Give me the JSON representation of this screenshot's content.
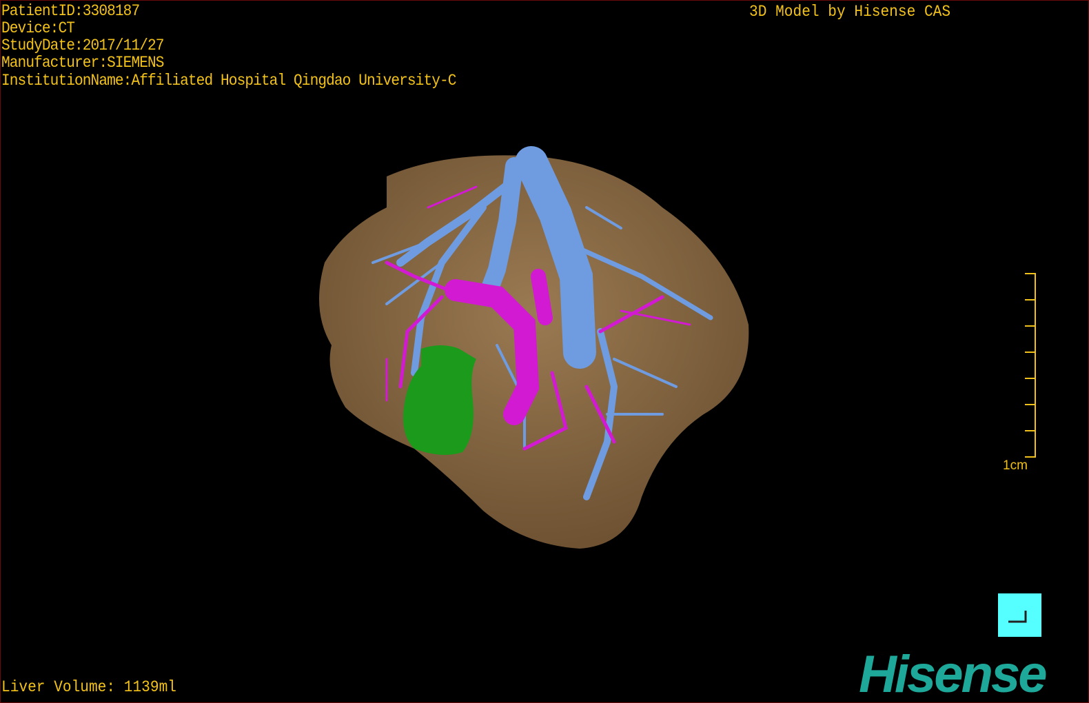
{
  "overlay": {
    "patient_id": "PatientID:3308187",
    "device": "Device:CT",
    "study_date": "StudyDate:2017/11/27",
    "manufacturer": "Manufacturer:SIEMENS",
    "institution": "InstitutionName:Affiliated Hospital Qingdao University-C",
    "credit": "3D Model by Hisense CAS",
    "liver_volume": "Liver Volume: 1139ml",
    "scale_label": "1cm"
  },
  "logo": "Hisense",
  "colors": {
    "text": "#f2c21a",
    "liver": "#8a6a44",
    "portal_vein": "#6f9be0",
    "hepatic_vein": "#d21ad2",
    "tumor": "#1c9a1c",
    "logo": "#1ea89a",
    "button": "#55ffff"
  },
  "icons": {
    "corner_button": "corner-bracket-icon"
  }
}
